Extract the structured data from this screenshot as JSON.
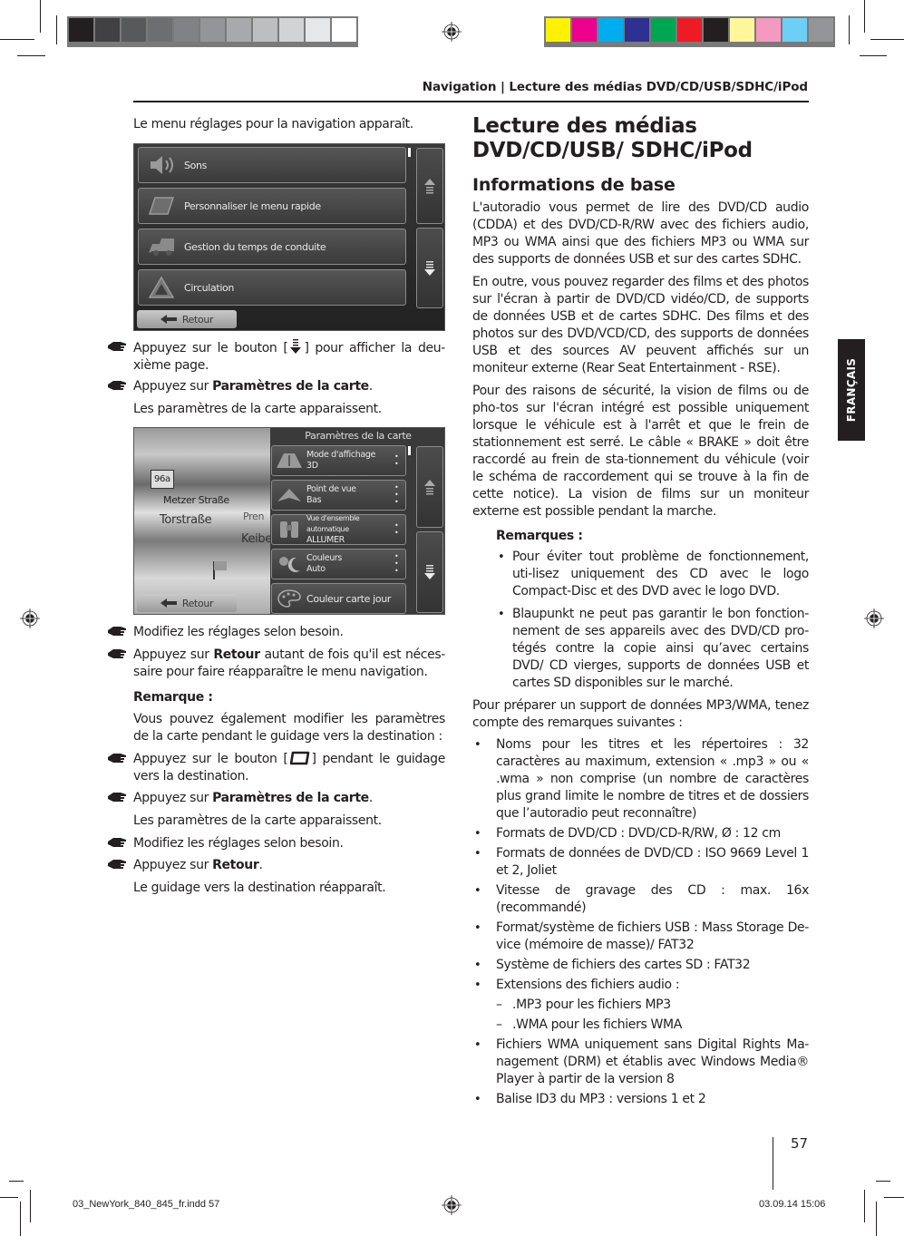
{
  "print_marks": {
    "gray_swatches": [
      "#231f20",
      "#414042",
      "#58595b",
      "#6d6e71",
      "#808285",
      "#939598",
      "#a7a9ac",
      "#bcbec0",
      "#d1d3d4",
      "#e6e7e8",
      "#ffffff"
    ],
    "color_swatches": [
      "#fff200",
      "#ec008c",
      "#00aeef",
      "#2e3192",
      "#00a651",
      "#ed1c24",
      "#231f20",
      "#fff799",
      "#f49ac1",
      "#6dcff6",
      "#939598"
    ]
  },
  "header": {
    "running_title": "Navigation | Lecture des médias DVD/CD/USB/SDHC/iPod"
  },
  "side_tab": {
    "language": "FRANÇAIS"
  },
  "left_column": {
    "intro": "Le menu réglages pour la navigation apparaît.",
    "screenshot1": {
      "menu_items": [
        {
          "icon": "speaker-icon",
          "label": "Sons"
        },
        {
          "icon": "quick-menu-icon",
          "label": "Personnaliser le menu rapide"
        },
        {
          "icon": "truck-icon",
          "label": "Gestion du temps de conduite"
        },
        {
          "icon": "warning-triangle-icon",
          "label": "Circulation"
        }
      ],
      "back_label": "Retour"
    },
    "steps1": [
      {
        "text_before": "Appuyez sur le bouton [",
        "icon": "scroll-down-icon",
        "text_after": "] pour afficher la deu-xième page."
      },
      {
        "text_before": "Appuyez sur ",
        "bold": "Paramètres de la carte",
        "text_after": "."
      }
    ],
    "result1": "Les paramètres de la carte apparaissent.",
    "screenshot2": {
      "title": "Paramètres de la carte",
      "map_labels": [
        "96a",
        "Metzer Straße",
        "Torstraße",
        "Pren",
        "Keibe"
      ],
      "settings": [
        {
          "icon": "road-3d-icon",
          "label": "Mode d'affichage",
          "value": "3D"
        },
        {
          "icon": "viewpoint-icon",
          "label": "Point de vue",
          "value": "Bas"
        },
        {
          "icon": "binoculars-icon",
          "label": "Vue d'ensemble automatique",
          "value": "ALLUMER"
        },
        {
          "icon": "sun-moon-icon",
          "label": "Couleurs",
          "value": "Auto"
        },
        {
          "icon": "palette-icon",
          "label": "Couleur carte jour",
          "value": ""
        }
      ],
      "back_label": "Retour"
    },
    "steps2": [
      {
        "text": "Modifiez les réglages selon besoin."
      },
      {
        "text_before": "Appuyez sur ",
        "bold": "Retour",
        "text_after": " autant de fois qu'il est néces-saire pour faire réapparaître le menu navigation."
      }
    ],
    "note_title": "Remarque :",
    "note_text": "Vous pouvez également modifier les paramètres de la carte pendant le guidage vers la destination :",
    "steps3": [
      {
        "text_before": "Appuyez sur le bouton [",
        "icon": "map-button-icon",
        "text_after": "] pendant le guidage vers la destination."
      },
      {
        "text_before": "Appuyez sur ",
        "bold": "Paramètres de la carte",
        "text_after": "."
      }
    ],
    "result3": "Les paramètres de la carte apparaissent.",
    "steps4": [
      {
        "text": "Modifiez les réglages selon besoin."
      },
      {
        "text_before": "Appuyez sur ",
        "bold": "Retour",
        "text_after": "."
      }
    ],
    "result4": "Le guidage vers la destination réapparaît."
  },
  "right_column": {
    "title": "Lecture des médias DVD/CD/USB/ SDHC/iPod",
    "subtitle": "Informations de base",
    "paragraphs": [
      "L'autoradio vous permet de lire des DVD/CD audio (CDDA) et des DVD/CD-R/RW avec des fichiers audio, MP3 ou WMA ainsi que des fichiers MP3 ou WMA sur des supports de données USB et sur des cartes SDHC.",
      "En outre, vous pouvez regarder des films et des photos sur l'écran à partir de DVD/CD vidéo/CD, de supports de données USB et de cartes SDHC. Des films et des photos sur des DVD/VCD/CD, des supports de données USB et des sources AV peuvent affichés sur un moniteur externe (Rear Seat Entertainment - RSE).",
      "Pour des raisons de sécurité, la vision de films ou de pho-tos sur l'écran intégré est possible uniquement lorsque le véhicule est à l'arrêt et que le frein de stationnement est serré. Le câble « BRAKE » doit être raccordé au frein de sta-tionnement du véhicule (voir le schéma de raccordement qui se trouve à la fin de cette notice). La vision de films sur un moniteur externe est possible pendant la marche."
    ],
    "remarks_title": "Remarques :",
    "remarks": [
      "Pour éviter tout problème de fonctionnement, uti-lisez uniquement des CD avec le logo Compact-Disc et des DVD avec le logo DVD.",
      "Blaupunkt ne peut pas garantir le bon fonction-nement de ses appareils avec des DVD/CD pro-tégés contre la copie ainsi qu’avec certains DVD/ CD vierges, supports de données USB et cartes SD disponibles sur le marché."
    ],
    "prep_text": "Pour préparer un support de données MP3/WMA, tenez compte des remarques suivantes :",
    "requirements": [
      "Noms pour les titres et les répertoires : 32 caractères au maximum, extension « .mp3 » ou « .wma » non comprise (un nombre de caractères plus grand limite le nombre de titres et de dossiers que l’autoradio peut reconnaître)",
      "Formats de DVD/CD : DVD/CD-R/RW, Ø : 12 cm",
      "Formats de données de DVD/CD : ISO 9669 Level 1 et 2, Joliet",
      "Vitesse de gravage des CD : max. 16x (recommandé)",
      "Format/système de fichiers USB : Mass Storage De-vice (mémoire de masse)/ FAT32",
      "Système de fichiers des cartes SD : FAT32",
      "Extensions des fichiers audio :"
    ],
    "extensions": [
      ".MP3 pour les fichiers MP3",
      ".WMA pour les fichiers WMA"
    ],
    "requirements2": [
      "Fichiers WMA uniquement sans Digital Rights Ma-nagement (DRM) et établis avec Windows Media® Player à partir de la version 8",
      "Balise ID3 du MP3 : versions 1 et 2"
    ]
  },
  "footer": {
    "page_number": "57",
    "file_name": "03_NewYork_840_845_fr.indd   57",
    "timestamp": "03.09.14   15:06"
  }
}
